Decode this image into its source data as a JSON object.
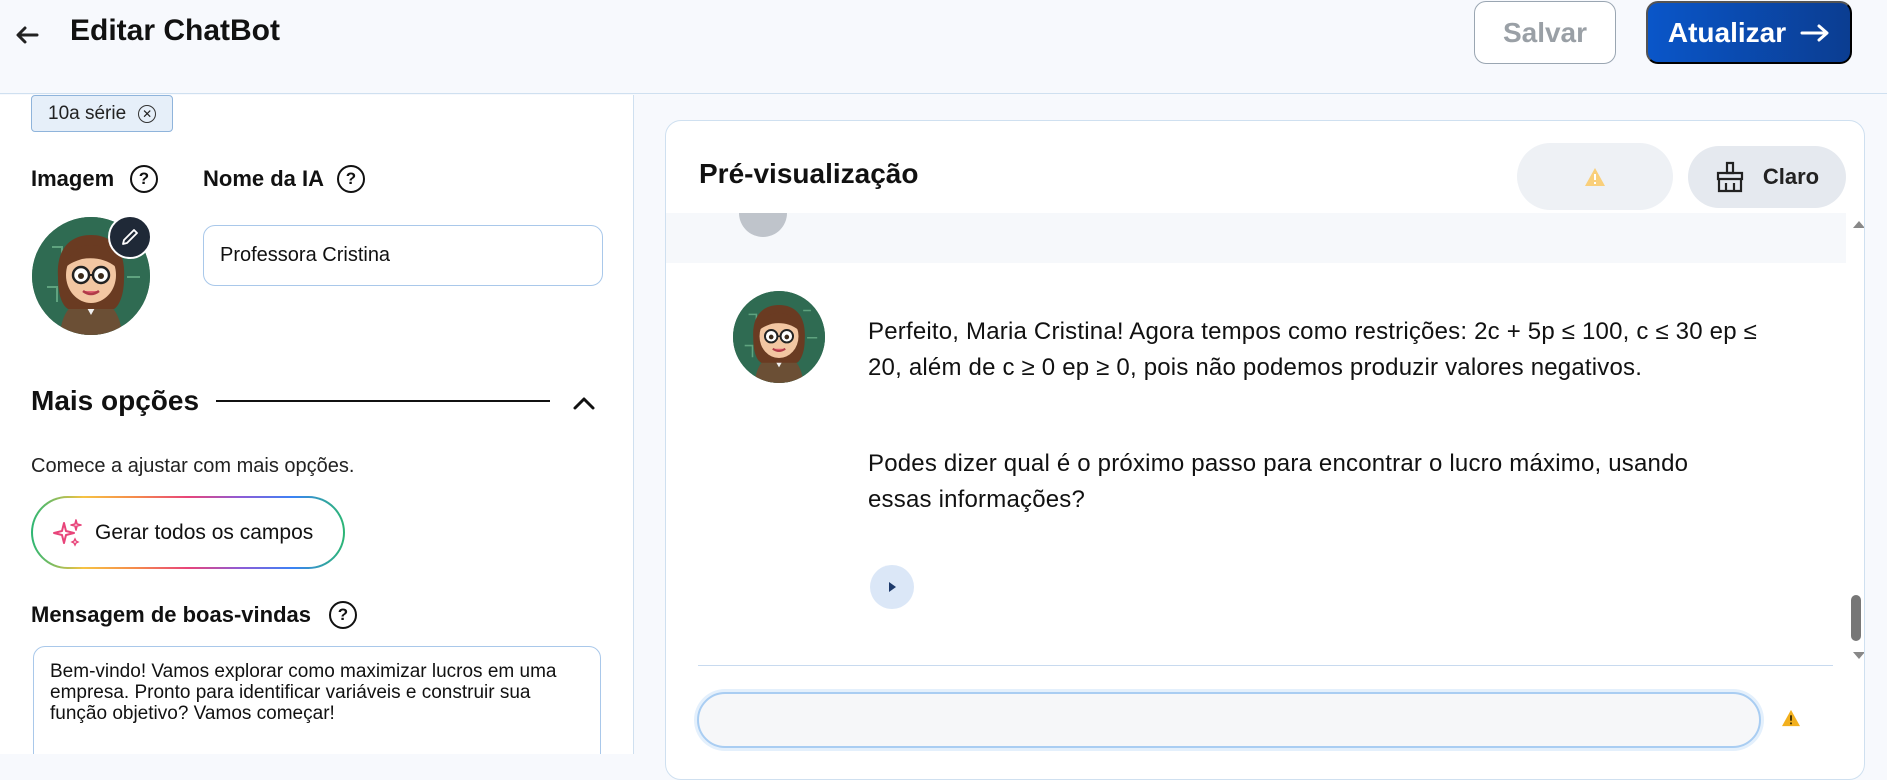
{
  "header": {
    "title": "Editar ChatBot",
    "save_label": "Salvar",
    "update_label": "Atualizar"
  },
  "left": {
    "tag_label": "10a série",
    "image_label": "Imagem",
    "ai_name_label": "Nome da IA",
    "help_symbol": "?",
    "ai_name_value": "Professora Cristina",
    "more_options_title": "Mais opções",
    "more_options_hint": "Comece a ajustar com mais opções.",
    "generate_all_label": "Gerar todos os campos",
    "welcome_label": "Mensagem de boas-vindas",
    "welcome_text": "Bem-vindo! Vamos explorar como maximizar lucros em uma empresa. Pronto para identificar variáveis e construir sua função objetivo? Vamos começar!"
  },
  "preview": {
    "title": "Pré-visualização",
    "theme_label": "Claro",
    "message_paragraph_1": "Perfeito, Maria Cristina! Agora tempos como restrições: 2c + 5p ≤ 100, c ≤ 30 ep ≤ 20, além de c ≥ 0 ep ≥ 0, pois não podemos produzir valores negativos.",
    "message_paragraph_2": "Podes dizer qual é o próximo passo para encontrar o lucro máximo, usando essas informações?",
    "input_value": ""
  },
  "icons": {
    "back": "arrow-left-icon",
    "arrow_right": "arrow-right-icon",
    "tag_close": "close-circle-icon",
    "help": "question-circle-icon",
    "edit": "pencil-icon",
    "chevron": "chevron-up-icon",
    "sparkle": "sparkle-icon",
    "warning": "warning-icon",
    "broom": "broom-icon",
    "play": "play-icon"
  },
  "colors": {
    "primary": "#0a56c9",
    "primary_dark": "#0b3d91",
    "warning": "#f2b01e",
    "border": "#a9c8ea"
  }
}
